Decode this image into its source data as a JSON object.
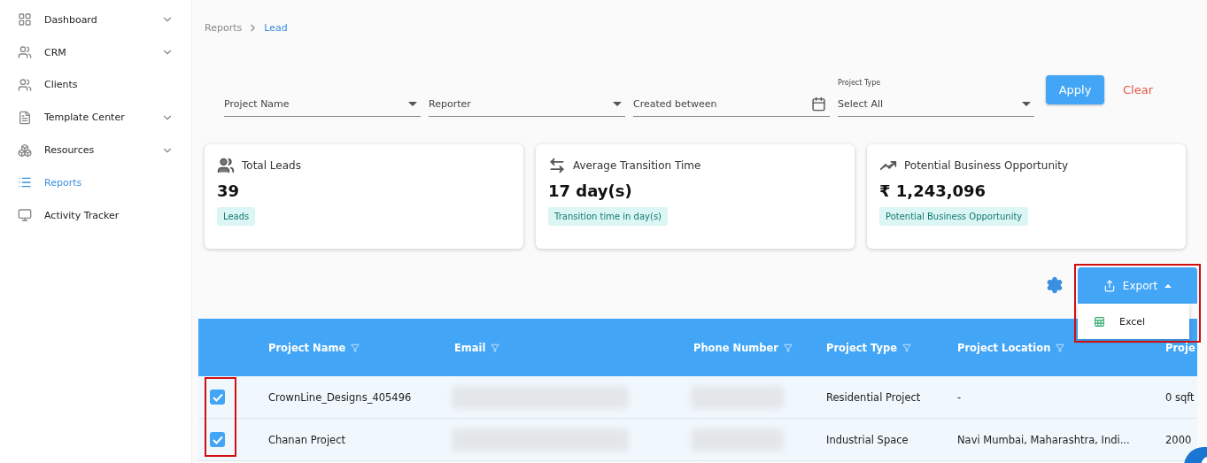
{
  "sidebar": {
    "items": [
      {
        "label": "Dashboard",
        "expandable": true,
        "selected": false
      },
      {
        "label": "CRM",
        "expandable": true,
        "selected": false
      },
      {
        "label": "Clients",
        "expandable": false,
        "selected": false
      },
      {
        "label": "Template Center",
        "expandable": true,
        "selected": false
      },
      {
        "label": "Resources",
        "expandable": true,
        "selected": false
      },
      {
        "label": "Reports",
        "expandable": false,
        "selected": true
      },
      {
        "label": "Activity Tracker",
        "expandable": false,
        "selected": false
      }
    ]
  },
  "breadcrumb": [
    "Reports",
    "Lead"
  ],
  "filters": [
    {
      "kind": "select",
      "placeholder": "Project Name"
    },
    {
      "kind": "select",
      "placeholder": "Reporter"
    },
    {
      "kind": "date",
      "placeholder": "Created between"
    },
    {
      "kind": "labeled-select",
      "label": "Project Type",
      "value": "Select All"
    }
  ],
  "apply_button": "Apply",
  "clear_button": "Clear",
  "cards": [
    {
      "title": "Total Leads",
      "value": "39",
      "tag": "Leads"
    },
    {
      "title": "Average Transition Time",
      "value": "17 day(s)",
      "tag": "Transition time in day(s)"
    },
    {
      "title": "Potential Business Opportunity",
      "value": "₹ 1,243,096",
      "tag": "Potential Business Opportunity"
    }
  ],
  "export": {
    "label": "Export",
    "expanded": true,
    "menu": [
      "Excel"
    ]
  },
  "table": {
    "columns": [
      "Project Name",
      "Email",
      "Phone Number",
      "Project Type",
      "Project Location",
      "Proje"
    ],
    "rows": [
      {
        "checked": true,
        "cells": [
          "CrownLine_Designs_405496",
          "",
          "",
          "Residential Project",
          "-",
          "0 sqft"
        ]
      },
      {
        "checked": true,
        "cells": [
          "Chanan Project",
          "",
          "",
          "Industrial Space",
          "Navi Mumbai, Maharashtra, Indi...",
          "2000"
        ]
      }
    ]
  }
}
